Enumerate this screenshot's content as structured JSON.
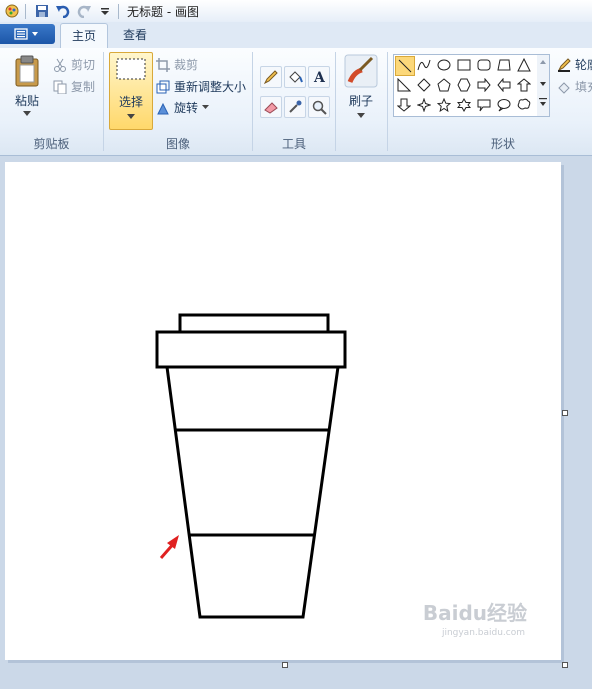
{
  "window": {
    "title": "无标题 - 画图"
  },
  "tabs": [
    {
      "label": "主页"
    },
    {
      "label": "查看"
    }
  ],
  "ribbon": {
    "clipboard": {
      "group_label": "剪贴板",
      "paste": "粘贴",
      "cut": "剪切",
      "copy": "复制"
    },
    "image": {
      "group_label": "图像",
      "select": "选择",
      "crop": "裁剪",
      "resize": "重新调整大小",
      "rotate": "旋转"
    },
    "tools": {
      "group_label": "工具"
    },
    "brushes": {
      "label": "刷子"
    },
    "shapes": {
      "group_label": "形状",
      "outline": "轮廓",
      "fill": "填充"
    }
  },
  "watermark": {
    "text": "Baidu经验",
    "url": "jingyan.baidu.com"
  },
  "colors": {
    "accent": "#2a62b4",
    "select_active": "#ffd86b",
    "arrow": "#e02020"
  }
}
